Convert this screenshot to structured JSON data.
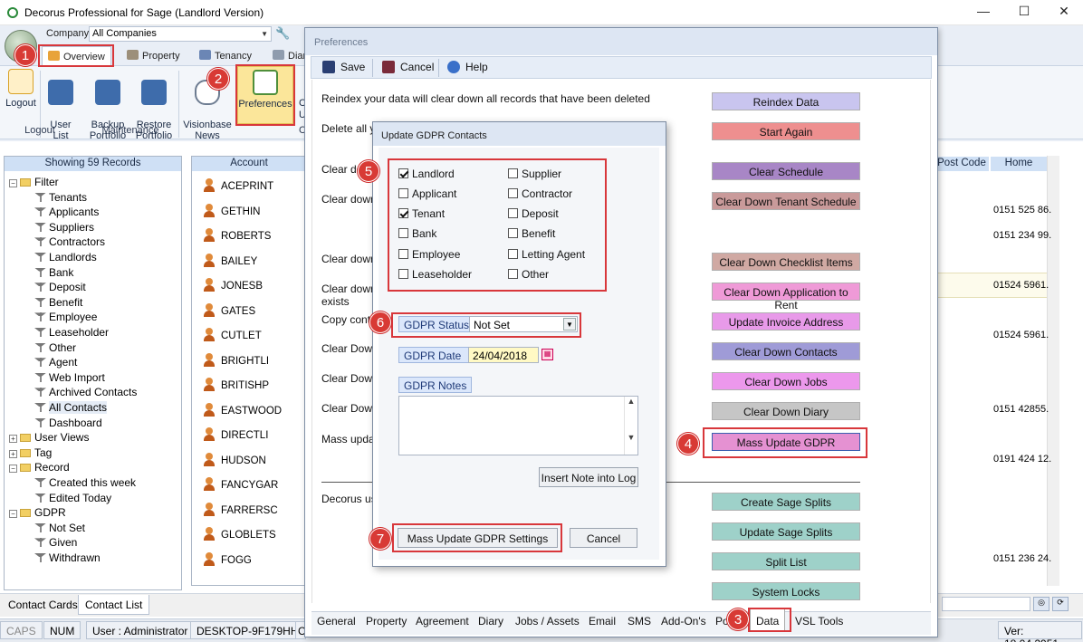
{
  "window": {
    "title": "Decorus Professional  for Sage (Landlord Version)",
    "controls": [
      "—",
      "☐",
      "✕"
    ]
  },
  "company": {
    "label": "Company",
    "value": "All Companies"
  },
  "ribbon": {
    "tabs": [
      "Overview",
      "Property",
      "Tenancy",
      "Diar"
    ],
    "buttons": [
      {
        "label": "Logout",
        "icon": "logout-icon",
        "color": "#d9a227"
      },
      {
        "label": "User\nList",
        "icon": "users-icon",
        "color": "#3e6cab"
      },
      {
        "label": "Backup\nPortfolio",
        "icon": "backup-icon",
        "color": "#3e6cab"
      },
      {
        "label": "Restore\nPortfolio",
        "icon": "restore-icon",
        "color": "#3e6cab"
      },
      {
        "label": "Visionbase\nNews",
        "icon": "news-icon",
        "color": "#6d7c91"
      },
      {
        "label": "Preferences",
        "icon": "preferences-icon",
        "color": "#4f8f3a"
      }
    ],
    "groups": [
      "Logout",
      "Maintenance"
    ],
    "clipped": [
      "C",
      "U",
      "C"
    ]
  },
  "tree": {
    "header": "Showing 59 Records",
    "filter": "Filter",
    "filter_items": [
      "Tenants",
      "Applicants",
      "Suppliers",
      "Contractors",
      "Landlords",
      "Bank",
      "Deposit",
      "Benefit",
      "Employee",
      "Leaseholder",
      "Other",
      "Agent",
      "Web Import",
      "Archived Contacts",
      "All Contacts",
      "Dashboard"
    ],
    "user_views": "User Views",
    "tag": "Tag",
    "record": "Record",
    "record_items": [
      "Created this week",
      "Edited Today"
    ],
    "gdpr": "GDPR",
    "gdpr_items": [
      "Not Set",
      "Given",
      "Withdrawn"
    ]
  },
  "list": {
    "header": "Account",
    "accounts": [
      "ACEPRINT",
      "GETHIN",
      "ROBERTS",
      "BAILEY",
      "JONESB",
      "GATES",
      "CUTLET",
      "BRIGHTLI",
      "BRITISHP",
      "EASTWOOD",
      "DIRECTLI",
      "HUDSON",
      "FANCYGAR",
      "FARRERSC",
      "GLOBLETS",
      "FOGG"
    ]
  },
  "right_cols": {
    "post_code": "Post Code",
    "home": "Home",
    "home_values": [
      {
        "row": 1,
        "v": "0151 525 86."
      },
      {
        "row": 2,
        "v": "0151 234 99."
      },
      {
        "row": 4,
        "v": "01524 5961."
      },
      {
        "row": 6,
        "v": "01524 5961."
      },
      {
        "row": 9,
        "v": "0151 42855."
      },
      {
        "row": 11,
        "v": "0191 424 12."
      },
      {
        "row": 15,
        "v": "0151 236 24."
      }
    ]
  },
  "bottom_tabs": [
    "Contact Cards",
    "Contact List"
  ],
  "status": {
    "caps": "CAPS",
    "num": "NUM",
    "user": "User : Administrator",
    "machine": "DESKTOP-9F179HH",
    "clipped": "C",
    "version": "Ver: 18.04.2951"
  },
  "preferences": {
    "title": "Preferences",
    "toolbar": {
      "save": "Save",
      "cancel": "Cancel",
      "help": "Help"
    },
    "lines": [
      "Reindex your data will clear down all records that have been deleted",
      "Delete all y",
      "Clear do",
      "Clear down",
      "Clear down",
      "Clear down",
      "exists",
      "Copy cont",
      "Clear Down",
      "Clear Down",
      "Clear Down",
      "Mass upda",
      "Decorus us"
    ],
    "buttons": [
      {
        "label": "Reindex Data",
        "color": "#c9c5ef"
      },
      {
        "label": "Start Again",
        "color": "#ee8f8f"
      },
      {
        "label": "Clear Schedule",
        "color": "#a886c6"
      },
      {
        "label": "Clear Down Tenant Schedule",
        "color": "#c99a9a"
      },
      {
        "label": "Clear Down Checklist Items",
        "color": "#d0a9a3"
      },
      {
        "label": "Clear Down Application to Rent",
        "color": "#ef9ad7"
      },
      {
        "label": "Update Invoice Address",
        "color": "#e89ae9"
      },
      {
        "label": "Clear Down Contacts",
        "color": "#9f9bd7"
      },
      {
        "label": "Clear Down Jobs",
        "color": "#ec98ec"
      },
      {
        "label": "Clear Down Diary",
        "color": "#c6c6c6"
      },
      {
        "label": "Mass Update GDPR",
        "color": "#e591d2"
      },
      {
        "label": "Create Sage Splits",
        "color": "#9ed1c9"
      },
      {
        "label": "Update Sage Splits",
        "color": "#9ed1c9"
      },
      {
        "label": "Split List",
        "color": "#9ed1c9"
      },
      {
        "label": "System Locks",
        "color": "#9ed1c9"
      }
    ],
    "tabs": [
      "General",
      "Property",
      "Agreement",
      "Diary",
      "Jobs / Assets",
      "Email",
      "SMS",
      "Add-On's",
      "Po",
      "Data",
      "VSL Tools"
    ]
  },
  "gdpr": {
    "title": "Update GDPR Contacts",
    "checks_left": [
      {
        "label": "Landlord",
        "checked": true
      },
      {
        "label": "Applicant",
        "checked": false
      },
      {
        "label": "Tenant",
        "checked": true
      },
      {
        "label": "Bank",
        "checked": false
      },
      {
        "label": "Employee",
        "checked": false
      },
      {
        "label": "Leaseholder",
        "checked": false
      }
    ],
    "checks_right": [
      {
        "label": "Supplier",
        "checked": false
      },
      {
        "label": "Contractor",
        "checked": false
      },
      {
        "label": "Deposit",
        "checked": false
      },
      {
        "label": "Benefit",
        "checked": false
      },
      {
        "label": "Letting Agent",
        "checked": false
      },
      {
        "label": "Other",
        "checked": false
      }
    ],
    "status_label": "GDPR Status",
    "status_value": "Not Set",
    "date_label": "GDPR Date",
    "date_value": "24/04/2018",
    "notes_label": "GDPR Notes",
    "insert_note": "Insert Note into Log",
    "mass_update": "Mass Update GDPR Settings",
    "cancel": "Cancel"
  },
  "callouts": [
    "1",
    "2",
    "3",
    "4",
    "5",
    "6",
    "7"
  ],
  "colors": {
    "highlight": "#d8373b",
    "callout": "#d83a35",
    "ribbon": "#e9eef6",
    "header": "#cfe0f5"
  }
}
